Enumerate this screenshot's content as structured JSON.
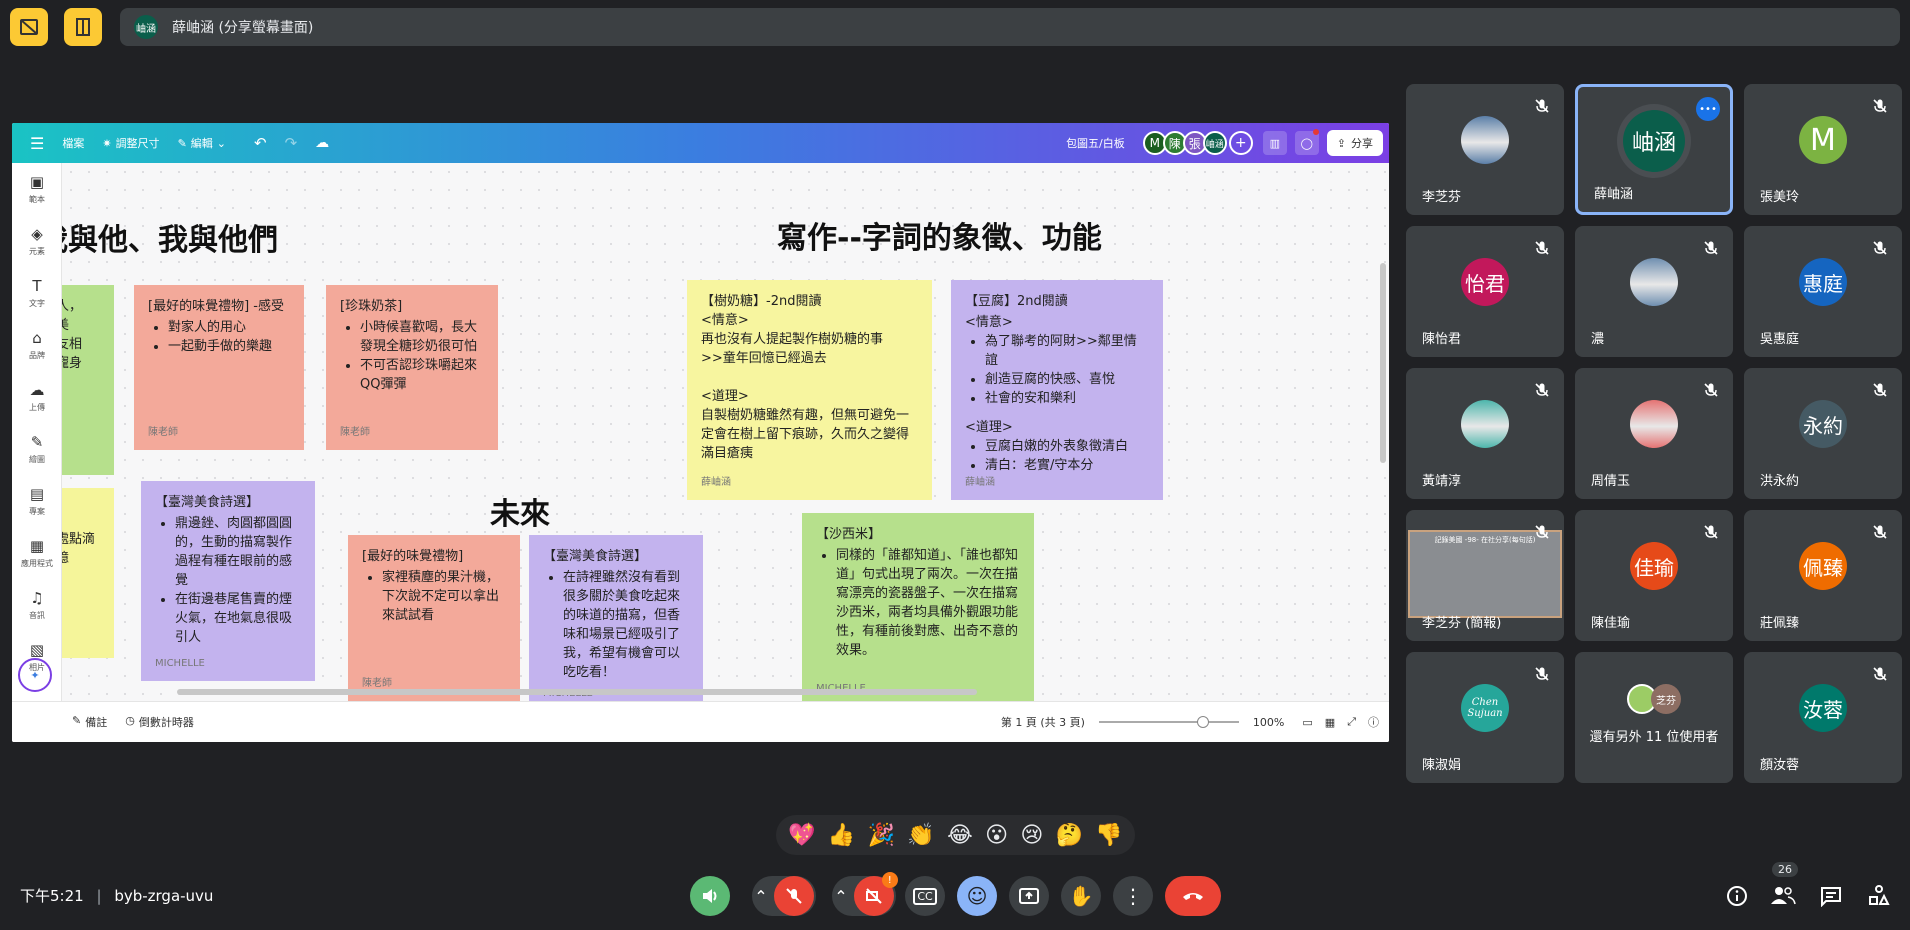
{
  "topbar": {
    "presenter_avatar": "岫涵",
    "presenter_label": "薛岫涵 (分享螢幕畫面)"
  },
  "canva": {
    "menu": "檔案",
    "resize": "調整尺寸",
    "edit": "編輯",
    "doc_title": "包圖五/白板",
    "collab": [
      {
        "t": "M",
        "c": "#1b5e20"
      },
      {
        "t": "陳",
        "c": "#2e7d32"
      },
      {
        "t": "張",
        "c": "#7e57c2"
      },
      {
        "t": "岫涵",
        "c": "#0b5e4b"
      }
    ],
    "share": "分享",
    "side": [
      "範本",
      "元素",
      "文字",
      "品牌",
      "上傳",
      "繪圖",
      "專案",
      "應用程式",
      "音訊",
      "相片"
    ],
    "notes_label": "備註",
    "timer_label": "倒數計時器",
    "page_label": "第 1 頁 (共 3 頁)",
    "zoom": "100%"
  },
  "board": {
    "h1": "我與他、我與他們",
    "h2": "寫作--字詞的象徵、功能",
    "h3": "未來",
    "n_left1": [
      "人，",
      "美",
      "友相",
      "寵身"
    ],
    "n_left2": [
      "處點滴",
      "憶"
    ],
    "n1": {
      "title": "[最好的味覺禮物]  -感受",
      "items": [
        "對家人的用心",
        "一起動手做的樂趣"
      ],
      "sig": "陳老師"
    },
    "n2": {
      "title": "[珍珠奶茶]",
      "items": [
        "小時候喜歡喝，長大發現全糖珍奶很可怕",
        "不可否認珍珠嚼起來QQ彈彈"
      ],
      "sig": "陳老師"
    },
    "n3": {
      "title": "【臺灣美食詩選】",
      "items": [
        "鼎邊銼、肉圓都圓圓的，生動的描寫製作過程有種在眼前的感覺",
        "在街邊巷尾售賣的煙火氣，在地氣息很吸引人"
      ],
      "sig": "MICHELLE"
    },
    "n4": {
      "title": "[最好的味覺禮物]",
      "items": [
        "家裡積塵的果汁機，下次說不定可以拿出來試試看"
      ],
      "sig": "陳老師"
    },
    "n5": {
      "title": "【臺灣美食詩選】",
      "items": [
        "在詩裡雖然沒有看到很多關於美食吃起來的味道的描寫，但香味和場景已經吸引了我，希望有機會可以吃吃看！"
      ],
      "sig": "MICHELLE"
    },
    "n6": {
      "lines": [
        "【樹奶糖】-2nd閱讀",
        "<情意>",
        "再也沒有人提起製作樹奶糖的事",
        ">>童年回憶已經過去",
        "",
        "<道理>",
        "自製樹奶糖雖然有趣，但無可避免一定會在樹上留下痕跡，久而久之變得滿目瘡痍"
      ],
      "sig": "薛岫涵"
    },
    "n7": {
      "title": "【豆腐】2nd閱讀",
      "sub1": "<情意>",
      "items1": [
        "為了聯考的阿財>>鄰里情誼",
        "創造豆腐的快感、喜悅",
        "社會的安和樂利"
      ],
      "sub2": "<道理>",
      "items2": [
        "豆腐白嫩的外表象徵清白",
        "清白：老實/守本分"
      ],
      "sig": "薛岫涵"
    },
    "n8": {
      "title": "【沙西米】",
      "items": [
        "同樣的「誰都知道」、「誰也都知道」句式出現了兩次。一次在描寫漂亮的瓷器盤子、一次在描寫沙西米，兩者均具備外觀跟功能性，有種前後對應、出奇不意的效果。"
      ],
      "sig": "MICHELLE"
    }
  },
  "participants": [
    {
      "name": "李芝芬",
      "type": "photo",
      "c": "#5b7fa8"
    },
    {
      "name": "薛岫涵",
      "type": "text",
      "t": "岫涵",
      "c": "#0b5e4b",
      "active": true
    },
    {
      "name": "張美玲",
      "type": "text",
      "t": "M",
      "c": "#7cb342"
    },
    {
      "name": "陳怡君",
      "type": "text",
      "t": "怡君",
      "c": "#c2185b"
    },
    {
      "name": "濃",
      "type": "photo",
      "c": "#6f8fb0"
    },
    {
      "name": "吳惠庭",
      "type": "text",
      "t": "惠庭",
      "c": "#1565c0"
    },
    {
      "name": "黃靖淳",
      "type": "photo",
      "c": "#4db6ac"
    },
    {
      "name": "周倩玉",
      "type": "photo",
      "c": "#e57373"
    },
    {
      "name": "洪永約",
      "type": "text",
      "t": "永約",
      "c": "#455a64"
    },
    {
      "name": "李芝芬 (簡報)",
      "type": "screen",
      "c": "#777"
    },
    {
      "name": "陳佳瑜",
      "type": "text",
      "t": "佳瑜",
      "c": "#e64a19"
    },
    {
      "name": "莊佩臻",
      "type": "text",
      "t": "佩臻",
      "c": "#ef6c00"
    },
    {
      "name": "陳淑娟",
      "type": "photo",
      "c": "#26a69a"
    },
    {
      "name": "還有另外 11 位使用者",
      "type": "more",
      "t": "芝芬",
      "c": "#8d6e63"
    },
    {
      "name": "顏汝蓉",
      "type": "text",
      "t": "汝蓉",
      "c": "#00796b"
    }
  ],
  "screen_share_tile_text": "記錄美國 -98- 在社分享(每句話)",
  "photo_signature": [
    "Chen",
    "Sujuan"
  ],
  "reactions": [
    "💖",
    "👍",
    "🎉",
    "👏",
    "😂",
    "😮",
    "😢",
    "🤔",
    "👎"
  ],
  "footer": {
    "time": "下午5:21",
    "code": "byb-zrga-uvu",
    "people_count": "26"
  },
  "colors": {
    "bg": "#202124",
    "tile": "#3c4043",
    "accent": "#8ab4f8",
    "end": "#ea4335"
  }
}
